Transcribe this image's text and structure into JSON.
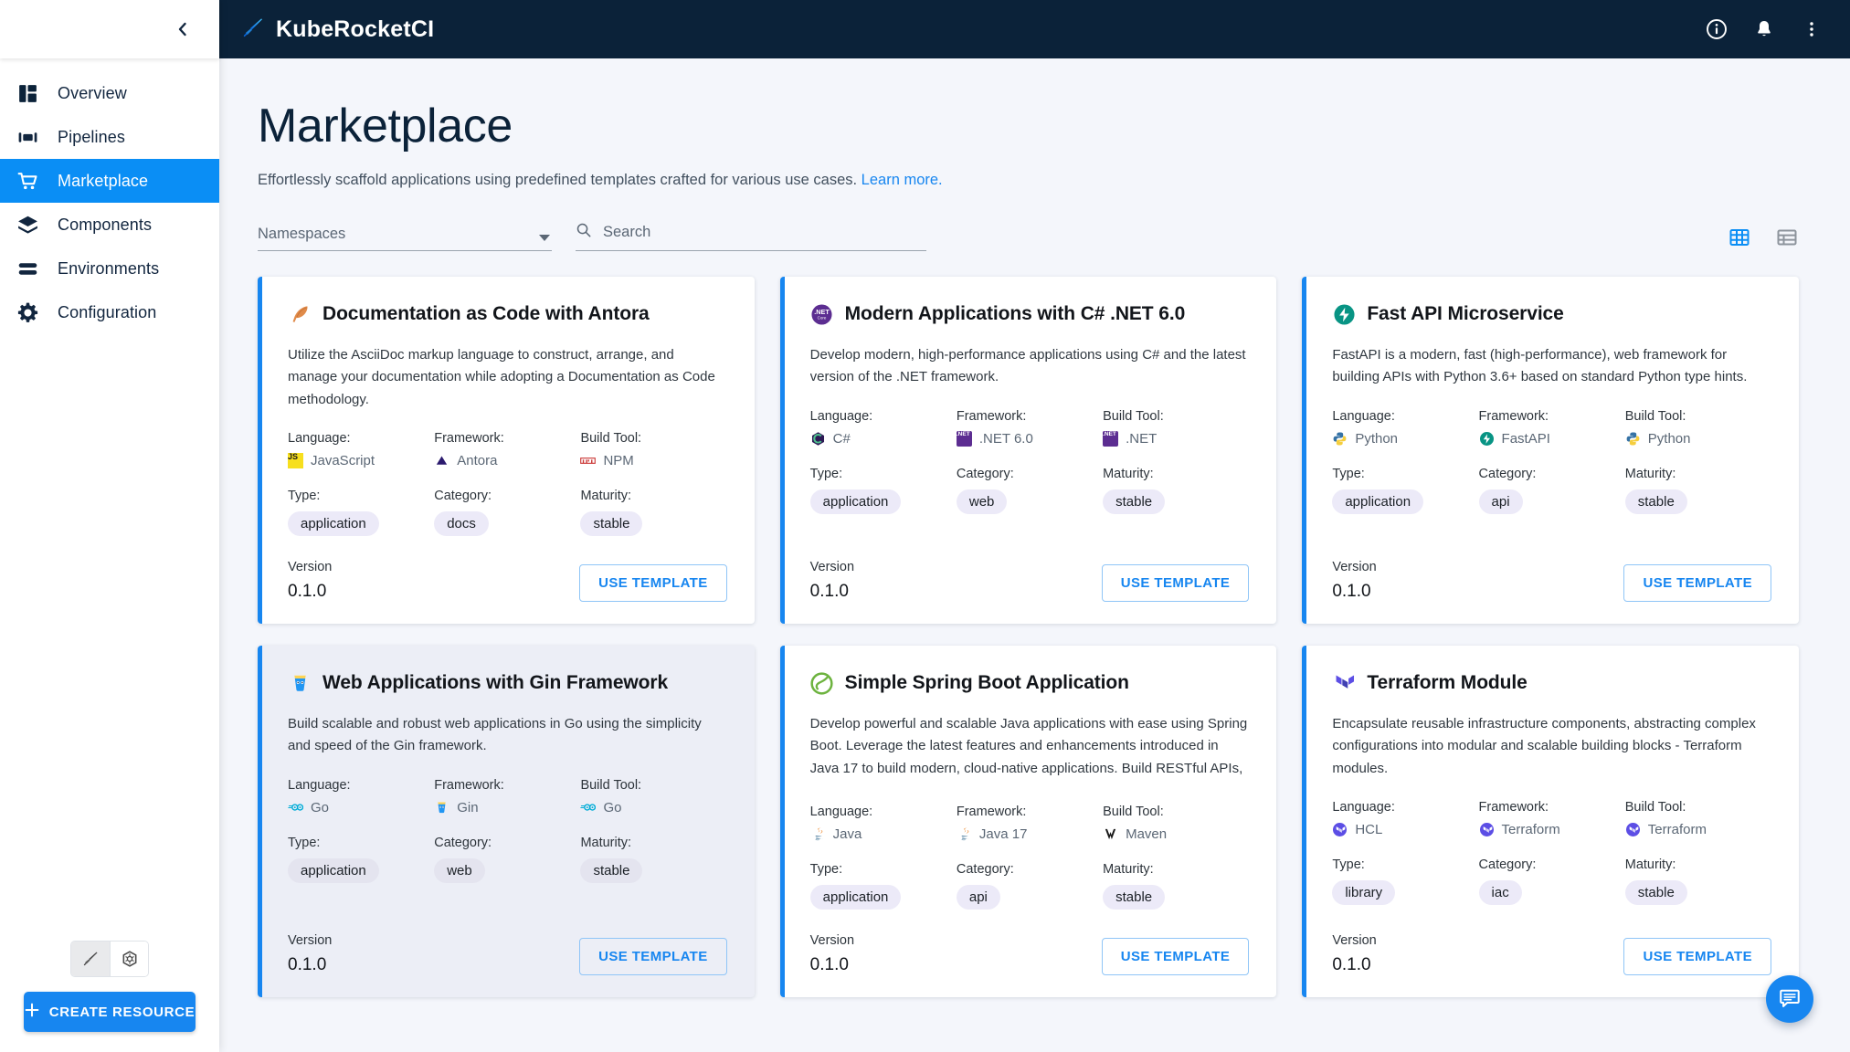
{
  "app": {
    "brand_name": "KubeRocketCI",
    "brand_icon": "rocket-logo-icon",
    "info_icon": "info-icon",
    "notifications_icon": "bell-icon",
    "overflow_icon": "kebab-menu-icon"
  },
  "sidebar": {
    "collapse_icon": "chevron-left-icon",
    "items": [
      {
        "label": "Overview",
        "icon": "dashboard-icon",
        "active": false
      },
      {
        "label": "Pipelines",
        "icon": "pipelines-icon",
        "active": false
      },
      {
        "label": "Marketplace",
        "icon": "cart-icon",
        "active": true
      },
      {
        "label": "Components",
        "icon": "layers-icon",
        "active": false
      },
      {
        "label": "Environments",
        "icon": "environments-icon",
        "active": false
      },
      {
        "label": "Configuration",
        "icon": "gear-icon",
        "active": false
      }
    ],
    "mode_toggle": [
      {
        "icon": "rocket-sword-icon",
        "selected": true
      },
      {
        "icon": "kubernetes-icon",
        "selected": false
      }
    ],
    "create_resource_label": "CREATE RESOURCE",
    "create_resource_icon": "plus-icon"
  },
  "page": {
    "title": "Marketplace",
    "subtitle": "Effortlessly scaffold applications using predefined templates crafted for various use cases.",
    "learn_more_label": "Learn more."
  },
  "filters": {
    "namespaces_label": "Namespaces",
    "namespaces_value": "",
    "caret_icon": "chevron-down-icon",
    "search_icon": "search-icon",
    "search_placeholder": "Search",
    "search_value": "",
    "views": [
      {
        "icon": "grid-view-icon",
        "active": true
      },
      {
        "icon": "table-view-icon",
        "active": false
      }
    ]
  },
  "labels": {
    "language": "Language:",
    "framework": "Framework:",
    "build_tool": "Build Tool:",
    "type": "Type:",
    "category": "Category:",
    "maturity": "Maturity:",
    "version": "Version",
    "use_template": "USE TEMPLATE"
  },
  "colors": {
    "accent_blue": "#1786f0",
    "sidebar_active": "#0a8ef5",
    "topbar_navy": "#0b2239",
    "page_bg": "#f4f6fb",
    "chip_bg": "#eceaf8",
    "card_hover_bg": "#eceef6"
  },
  "cards": [
    {
      "logo_icon": "antora-feather-icon",
      "title": "Documentation as Code with Antora",
      "description": "Utilize the AsciiDoc markup language to construct, arrange, and manage your documentation while adopting a Documentation as Code methodology.",
      "language": "JavaScript",
      "language_icon": "javascript-icon",
      "framework": "Antora",
      "framework_icon": "antora-icon",
      "build_tool": "NPM",
      "build_tool_icon": "npm-icon",
      "type": "application",
      "category": "docs",
      "maturity": "stable",
      "version": "0.1.0",
      "hovered": false
    },
    {
      "logo_icon": "dotnet-icon",
      "title": "Modern Applications with C# .NET 6.0",
      "description": "Develop modern, high-performance applications using C# and the latest version of the .NET framework.",
      "language": "C#",
      "language_icon": "csharp-icon",
      "framework": ".NET 6.0",
      "framework_icon": "dotnet-badge-icon",
      "build_tool": ".NET",
      "build_tool_icon": "dotnet-badge-icon",
      "type": "application",
      "category": "web",
      "maturity": "stable",
      "version": "0.1.0",
      "hovered": false
    },
    {
      "logo_icon": "fastapi-icon",
      "title": "Fast API Microservice",
      "description": "FastAPI is a modern, fast (high-performance), web framework for building APIs with Python 3.6+ based on standard Python type hints.",
      "language": "Python",
      "language_icon": "python-icon",
      "framework": "FastAPI",
      "framework_icon": "fastapi-icon",
      "build_tool": "Python",
      "build_tool_icon": "python-icon",
      "type": "application",
      "category": "api",
      "maturity": "stable",
      "version": "0.1.0",
      "hovered": false
    },
    {
      "logo_icon": "gin-icon",
      "title": "Web Applications with Gin Framework",
      "description": "Build scalable and robust web applications in Go using the simplicity and speed of the Gin framework.",
      "language": "Go",
      "language_icon": "go-icon",
      "framework": "Gin",
      "framework_icon": "gin-icon",
      "build_tool": "Go",
      "build_tool_icon": "go-icon",
      "type": "application",
      "category": "web",
      "maturity": "stable",
      "version": "0.1.0",
      "hovered": true
    },
    {
      "logo_icon": "spring-icon",
      "title": "Simple Spring Boot Application",
      "description": "Develop powerful and scalable Java applications with ease using Spring Boot. Leverage the latest features and enhancements introduced in Java 17 to build modern, cloud-native applications. Build RESTful APIs, integrate with databases, implement security, and deploy…",
      "language": "Java",
      "language_icon": "java-icon",
      "framework": "Java 17",
      "framework_icon": "java-icon",
      "build_tool": "Maven",
      "build_tool_icon": "maven-icon",
      "type": "application",
      "category": "api",
      "maturity": "stable",
      "version": "0.1.0",
      "hovered": false
    },
    {
      "logo_icon": "terraform-icon",
      "title": "Terraform Module",
      "description": "Encapsulate reusable infrastructure components, abstracting complex configurations into modular and scalable building blocks - Terraform modules.",
      "language": "HCL",
      "language_icon": "terraform-badge-icon",
      "framework": "Terraform",
      "framework_icon": "terraform-badge-icon",
      "build_tool": "Terraform",
      "build_tool_icon": "terraform-badge-icon",
      "type": "library",
      "category": "iac",
      "maturity": "stable",
      "version": "0.1.0",
      "hovered": false
    }
  ],
  "fab": {
    "icon": "chat-bubble-icon"
  }
}
